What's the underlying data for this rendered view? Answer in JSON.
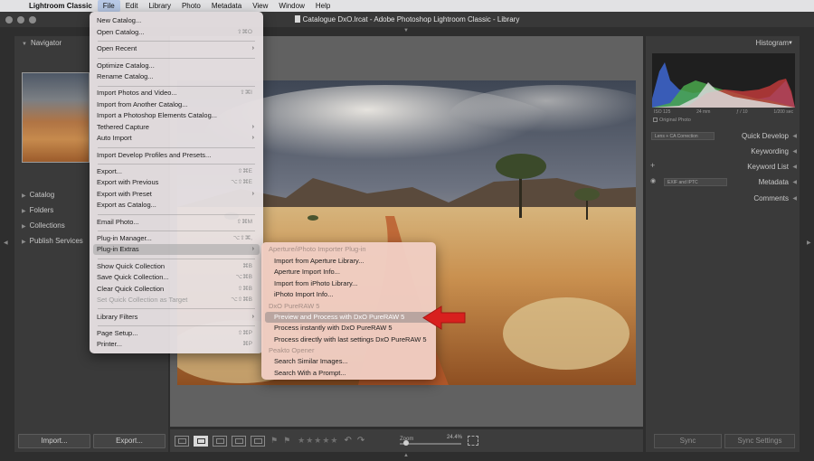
{
  "menubar": {
    "app_name": "Lightroom Classic",
    "items": [
      "File",
      "Edit",
      "Library",
      "Photo",
      "Metadata",
      "View",
      "Window",
      "Help"
    ]
  },
  "window": {
    "title": "Catalogue DxO.lrcat - Adobe Photoshop Lightroom Classic - Library"
  },
  "left_panel": {
    "navigator": "Navigator",
    "sections": [
      "Catalog",
      "Folders",
      "Collections",
      "Publish Services"
    ],
    "import_label": "Import...",
    "export_label": "Export..."
  },
  "right_panel": {
    "histogram": "Histogram",
    "hist_info": {
      "iso": "ISO 125",
      "focal": "24 mm",
      "aperture": "ƒ / 10",
      "shutter": "1/200 sec"
    },
    "original_photo": "Original Photo",
    "quick_develop_preset": "Lens + CA Correction",
    "quick_develop": "Quick Develop",
    "keywording": "Keywording",
    "keyword_list": "Keyword List",
    "metadata_preset": "EXIF and IPTC",
    "metadata": "Metadata",
    "comments": "Comments",
    "sync_label": "Sync",
    "sync_settings_label": "Sync Settings"
  },
  "toolbar": {
    "zoom_label": "Zoom",
    "zoom_value": "24.4%",
    "zoom_fraction": 0.1
  },
  "file_menu": {
    "items": [
      {
        "label": "New Catalog...",
        "shortcut": ""
      },
      {
        "label": "Open Catalog...",
        "shortcut": "⇧⌘O"
      },
      {
        "label": "Open Recent",
        "shortcut": ""
      },
      {
        "label": "Optimize Catalog...",
        "shortcut": ""
      },
      {
        "label": "Rename Catalog...",
        "shortcut": ""
      },
      {
        "label": "Import Photos and Video...",
        "shortcut": "⇧⌘I"
      },
      {
        "label": "Import from Another Catalog...",
        "shortcut": ""
      },
      {
        "label": "Import a Photoshop Elements Catalog...",
        "shortcut": ""
      },
      {
        "label": "Tethered Capture",
        "shortcut": ""
      },
      {
        "label": "Auto Import",
        "shortcut": ""
      },
      {
        "label": "Import Develop Profiles and Presets...",
        "shortcut": ""
      },
      {
        "label": "Export...",
        "shortcut": "⇧⌘E"
      },
      {
        "label": "Export with Previous",
        "shortcut": "⌥⇧⌘E"
      },
      {
        "label": "Export with Preset",
        "shortcut": ""
      },
      {
        "label": "Export as Catalog...",
        "shortcut": ""
      },
      {
        "label": "Email Photo...",
        "shortcut": "⇧⌘M"
      },
      {
        "label": "Plug-in Manager...",
        "shortcut": "⌥⇧⌘,"
      },
      {
        "label": "Plug-in Extras",
        "shortcut": ""
      },
      {
        "label": "Show Quick Collection",
        "shortcut": "⌘B"
      },
      {
        "label": "Save Quick Collection...",
        "shortcut": "⌥⌘B"
      },
      {
        "label": "Clear Quick Collection",
        "shortcut": "⇧⌘B"
      },
      {
        "label": "Set Quick Collection as Target",
        "shortcut": "⌥⇧⌘B"
      },
      {
        "label": "Library Filters",
        "shortcut": ""
      },
      {
        "label": "Page Setup...",
        "shortcut": "⇧⌘P"
      },
      {
        "label": "Printer...",
        "shortcut": "⌘P"
      }
    ]
  },
  "plugin_submenu": {
    "items": [
      {
        "label": "Aperture/iPhoto Importer Plug-in",
        "header": true
      },
      {
        "label": "Import from Aperture Library...",
        "header": false
      },
      {
        "label": "Aperture Import Info...",
        "header": false
      },
      {
        "label": "Import from iPhoto Library...",
        "header": false
      },
      {
        "label": "iPhoto Import Info...",
        "header": false
      },
      {
        "label": "DxO PureRAW 5",
        "header": true
      },
      {
        "label": "Preview and Process with DxO PureRAW 5",
        "header": false
      },
      {
        "label": "Process instantly with DxO PureRAW 5",
        "header": false
      },
      {
        "label": "Process directly with last settings DxO PureRAW 5",
        "header": false
      },
      {
        "label": "Peakto Opener",
        "header": true
      },
      {
        "label": "Search Similar Images...",
        "header": false
      },
      {
        "label": "Search With a Prompt...",
        "header": false
      }
    ]
  },
  "colors": {
    "accent_arrow": "#d8201e",
    "menu_bg": "#e8e1e4",
    "submenu_bg": "#f0cec4"
  }
}
